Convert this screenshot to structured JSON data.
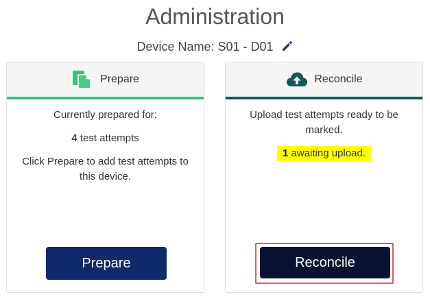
{
  "page": {
    "title": "Administration",
    "device_label": "Device Name: S01 - D01"
  },
  "icons": {
    "edit": "pencil-icon",
    "prepare": "document-copy-icon",
    "reconcile": "cloud-upload-icon"
  },
  "colors": {
    "prepare_accent": "#3fbf7f",
    "reconcile_accent": "#0f5b58",
    "prepare_button": "#10296a",
    "reconcile_button": "#071330",
    "highlight": "#ffff00",
    "focus_outline": "#e2585b"
  },
  "prepare": {
    "header": "Prepare",
    "line1": "Currently prepared for:",
    "count": "4",
    "count_suffix": " test attempts",
    "instructions": "Click Prepare to add test attempts to this device.",
    "button_label": "Prepare"
  },
  "reconcile": {
    "header": "Reconcile",
    "line1": "Upload test attempts ready to be marked.",
    "count": "1",
    "count_suffix": " awaiting upload.",
    "button_label": "Reconcile"
  }
}
